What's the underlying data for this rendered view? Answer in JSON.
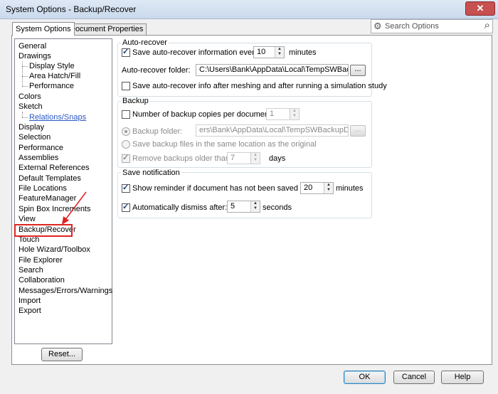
{
  "window": {
    "title": "System Options - Backup/Recover",
    "close_label": "✕"
  },
  "tabs": [
    {
      "label": "System Options"
    },
    {
      "label": "Document Properties"
    }
  ],
  "search": {
    "placeholder": "Search Options"
  },
  "tree": {
    "items": [
      {
        "label": "General"
      },
      {
        "label": "Drawings"
      },
      {
        "label": "Display Style"
      },
      {
        "label": "Area Hatch/Fill"
      },
      {
        "label": "Performance"
      },
      {
        "label": "Colors"
      },
      {
        "label": "Sketch"
      },
      {
        "label": "Relations/Snaps"
      },
      {
        "label": "Display"
      },
      {
        "label": "Selection"
      },
      {
        "label": "Performance"
      },
      {
        "label": "Assemblies"
      },
      {
        "label": "External References"
      },
      {
        "label": "Default Templates"
      },
      {
        "label": "File Locations"
      },
      {
        "label": "FeatureManager"
      },
      {
        "label": "Spin Box Increments"
      },
      {
        "label": "View"
      },
      {
        "label": "Backup/Recover"
      },
      {
        "label": "Touch"
      },
      {
        "label": "Hole Wizard/Toolbox"
      },
      {
        "label": "File Explorer"
      },
      {
        "label": "Search"
      },
      {
        "label": "Collaboration"
      },
      {
        "label": "Messages/Errors/Warnings"
      },
      {
        "label": "Import"
      },
      {
        "label": "Export"
      }
    ],
    "selected": "Backup/Recover"
  },
  "reset_label": "Reset...",
  "auto_recover": {
    "title": "Auto-recover",
    "save_every_label": "Save auto-recover information every:",
    "save_every_checked": true,
    "interval": "10",
    "interval_unit": "minutes",
    "folder_label": "Auto-recover folder:",
    "folder_value": "C:\\Users\\Bank\\AppData\\Local\\TempSWBackupDirec",
    "browse_label": "...",
    "meshing_label": "Save auto-recover info after meshing and after running a simulation study",
    "meshing_checked": false
  },
  "backup": {
    "title": "Backup",
    "copies_label": "Number of backup copies per document:",
    "copies_checked": false,
    "copies_value": "1",
    "folder_radio_label": "Backup folder:",
    "folder_value": "ers\\Bank\\AppData\\Local\\TempSWBackupDirectory",
    "browse_label": "...",
    "same_location_label": "Save backup files in the same location as the original",
    "remove_label": "Remove backups older than",
    "remove_checked": true,
    "remove_value": "7",
    "remove_unit": "days"
  },
  "save_notification": {
    "title": "Save notification",
    "reminder_label": "Show reminder if document has not been saved for:",
    "reminder_checked": true,
    "reminder_value": "20",
    "reminder_unit": "minutes",
    "dismiss_label": "Automatically dismiss after:",
    "dismiss_checked": true,
    "dismiss_value": "5",
    "dismiss_unit": "seconds"
  },
  "footer": {
    "ok_label": "OK",
    "cancel_label": "Cancel",
    "help_label": "Help"
  },
  "colors": {
    "highlight_box": "#e02424",
    "link": "#2b58c7"
  }
}
